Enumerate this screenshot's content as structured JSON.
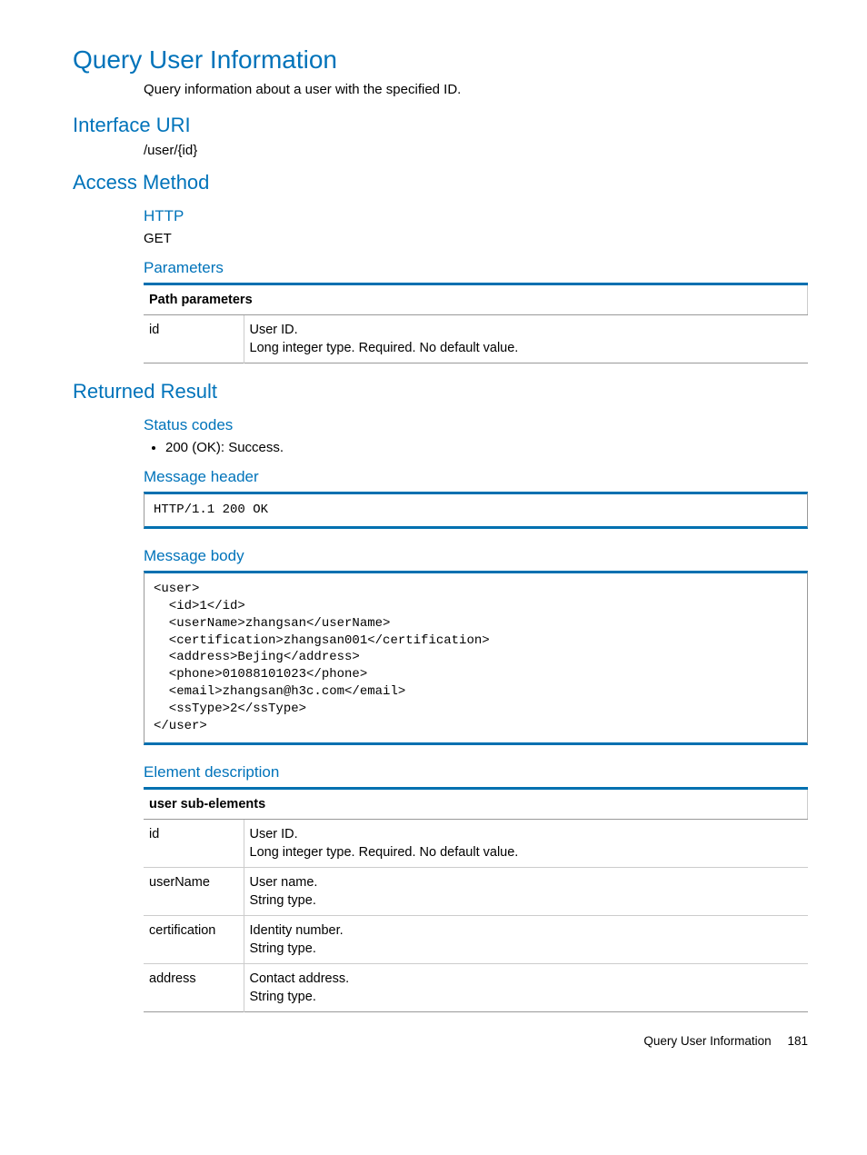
{
  "title": "Query User Information",
  "description": "Query information about a user with the specified ID.",
  "sections": {
    "interface_uri": {
      "heading": "Interface URI",
      "value": "/user/{id}"
    },
    "access_method": {
      "heading": "Access Method",
      "http_heading": "HTTP",
      "http_method": "GET",
      "parameters_heading": "Parameters",
      "path_params_header": "Path parameters",
      "path_params": [
        {
          "name": "id",
          "line1": "User ID.",
          "line2": "Long integer type. Required. No default value."
        }
      ]
    },
    "returned_result": {
      "heading": "Returned Result",
      "status_codes_heading": "Status codes",
      "status_codes": [
        "200 (OK): Success."
      ],
      "message_header_heading": "Message header",
      "message_header_code": "HTTP/1.1 200 OK",
      "message_body_heading": "Message body",
      "message_body_code": "<user>\n  <id>1</id>\n  <userName>zhangsan</userName>\n  <certification>zhangsan001</certification>\n  <address>Bejing</address>\n  <phone>01088101023</phone>\n  <email>zhangsan@h3c.com</email>\n  <ssType>2</ssType>\n</user>",
      "element_desc_heading": "Element description",
      "elements_header": "user sub-elements",
      "elements": [
        {
          "name": "id",
          "line1": "User ID.",
          "line2": "Long integer type. Required. No default value."
        },
        {
          "name": "userName",
          "line1": "User name.",
          "line2": "String type."
        },
        {
          "name": "certification",
          "line1": "Identity number.",
          "line2": "String type."
        },
        {
          "name": "address",
          "line1": "Contact address.",
          "line2": "String type."
        }
      ]
    }
  },
  "footer": {
    "title": "Query User Information",
    "page": "181"
  }
}
